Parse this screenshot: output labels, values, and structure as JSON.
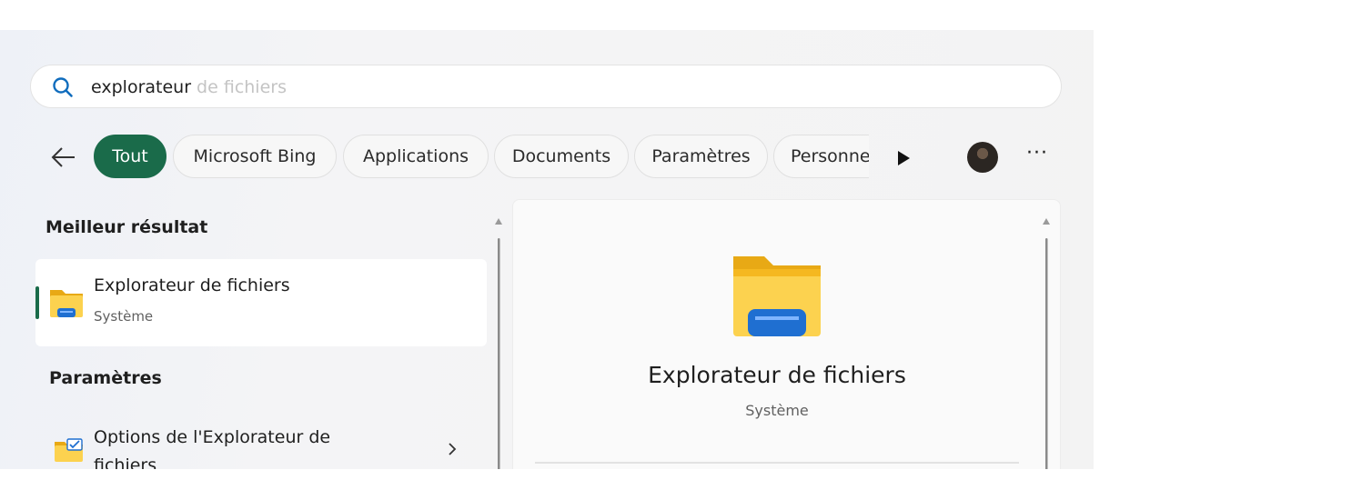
{
  "search": {
    "typed": "explorateur",
    "suggestion": " de fichiers"
  },
  "filters": {
    "back_icon": "arrow-left-icon",
    "chips": [
      {
        "label": "Tout",
        "active": true
      },
      {
        "label": "Microsoft Bing",
        "active": false
      },
      {
        "label": "Applications",
        "active": false
      },
      {
        "label": "Documents",
        "active": false
      },
      {
        "label": "Paramètres",
        "active": false
      },
      {
        "label": "Personnes",
        "active": false
      }
    ],
    "more_icon": "play-triangle-icon",
    "ellipsis": "···"
  },
  "results": {
    "best_heading": "Meilleur résultat",
    "best": {
      "title": "Explorateur de fichiers",
      "subtitle": "Système",
      "icon": "file-explorer-folder-icon"
    },
    "settings_heading": "Paramètres",
    "settings_items": [
      {
        "title": "Options de l'Explorateur de fichiers",
        "icon": "folder-options-icon"
      }
    ]
  },
  "preview": {
    "title": "Explorateur de fichiers",
    "subtitle": "Système",
    "icon": "file-explorer-folder-icon"
  },
  "colors": {
    "accent": "#1a6b4a",
    "search_icon": "#0f6cbd"
  }
}
